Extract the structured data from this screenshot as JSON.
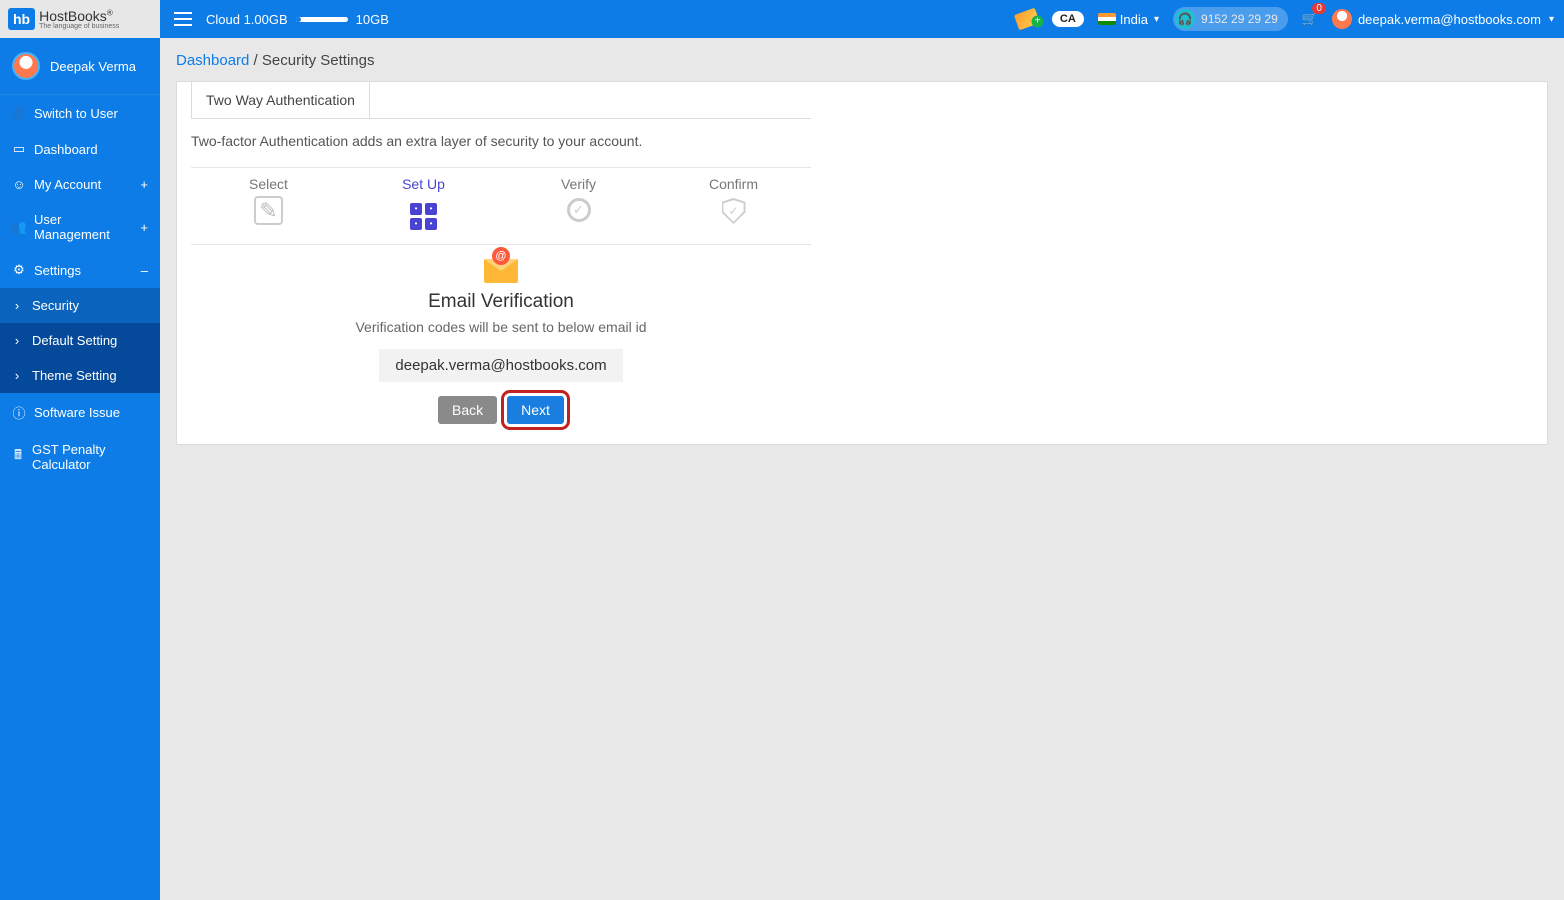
{
  "header": {
    "logo_main": "HostBooks",
    "logo_sub": "The language of business",
    "logo_badge": "hb",
    "cloud_used": "Cloud 1.00GB",
    "cloud_total": "10GB",
    "ca_label": "CA",
    "country": "India",
    "support_phone": "9152 29 29 29",
    "cart_badge": "0",
    "user_email": "deepak.verma@hostbooks.com"
  },
  "sidebar": {
    "profile_name": "Deepak Verma",
    "items": [
      {
        "label": "Switch to User",
        "icon": "user"
      },
      {
        "label": "Dashboard",
        "icon": "dashboard"
      },
      {
        "label": "My Account",
        "icon": "account",
        "suffix": "+"
      },
      {
        "label": "User Management",
        "icon": "users",
        "suffix": "+"
      },
      {
        "label": "Settings",
        "icon": "gear",
        "suffix": "–"
      }
    ],
    "settings_children": [
      {
        "label": "Security",
        "active": true
      },
      {
        "label": "Default Setting"
      },
      {
        "label": "Theme Setting"
      }
    ],
    "after": [
      {
        "label": "Software Issue",
        "icon": "info"
      },
      {
        "label": "GST Penalty Calculator",
        "icon": "calc"
      }
    ]
  },
  "breadcrumb": {
    "root": "Dashboard",
    "sep": " / ",
    "current": "Security Settings"
  },
  "tab_label": "Two Way Authentication",
  "description": "Two-factor Authentication adds an extra layer of security to your account.",
  "steps": [
    "Select",
    "Set Up",
    "Verify",
    "Confirm"
  ],
  "verify": {
    "title": "Email Verification",
    "subtitle": "Verification codes will be sent to below email id",
    "email": "deepak.verma@hostbooks.com",
    "back": "Back",
    "next": "Next"
  }
}
